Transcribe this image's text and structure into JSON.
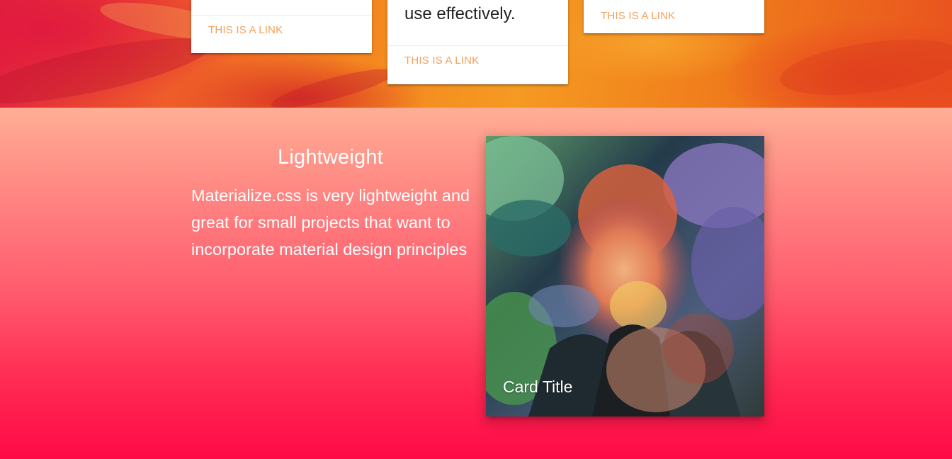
{
  "cards": [
    {
      "link": "THIS IS A LINK"
    },
    {
      "text": "use effectively.",
      "link": "THIS IS A LINK"
    },
    {
      "link": "THIS IS A LINK"
    }
  ],
  "feature": {
    "title": "Lightweight",
    "text": "Materialize.css is very lightweight and great for small projects that want to incorporate material design principles"
  },
  "image_card": {
    "title": "Card Title"
  },
  "colors": {
    "link": "#f5a05a",
    "gradient_top": "#ffae95",
    "gradient_bottom": "#ff0a46"
  }
}
